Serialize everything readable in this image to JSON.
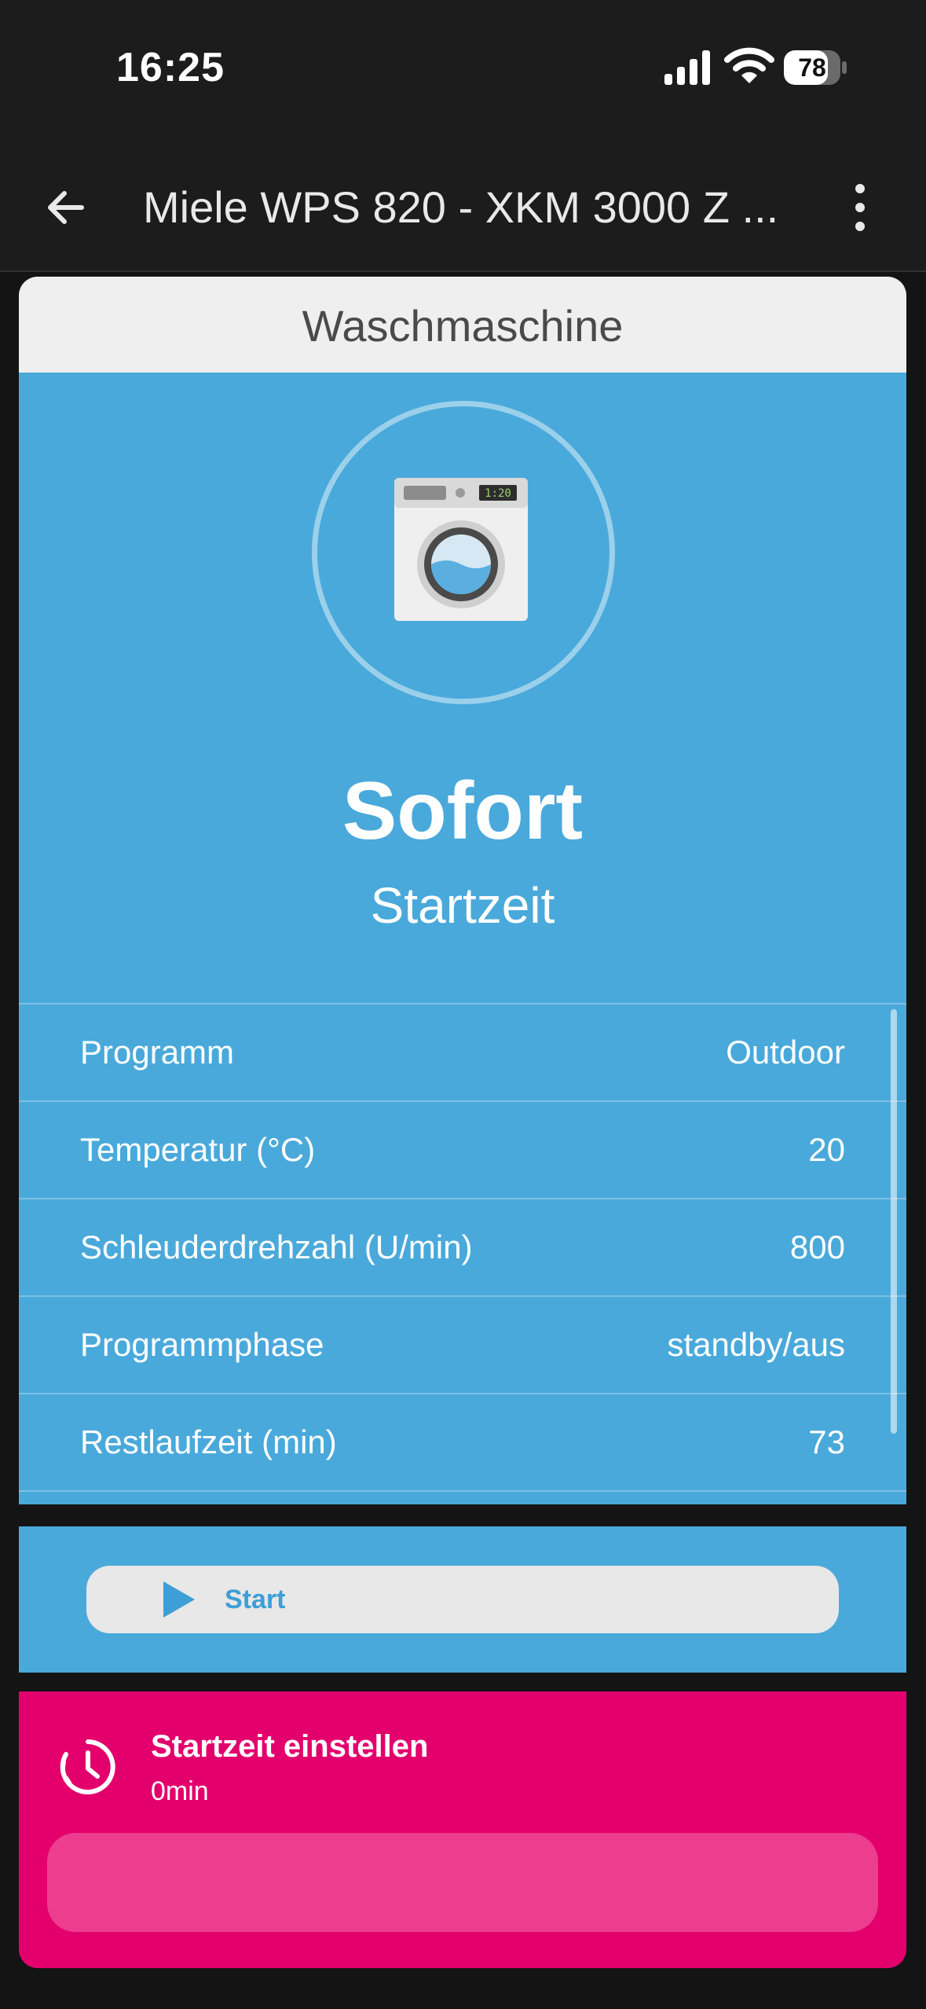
{
  "status_bar": {
    "time": "16:25",
    "battery_level": "78",
    "battery_fraction": 0.78
  },
  "app_bar": {
    "title": "Miele WPS 820 - XKM 3000 Z ...",
    "back_icon": "arrow-left-icon",
    "menu_icon": "more-vertical-icon"
  },
  "card": {
    "header": "Waschmaschine",
    "device_icon": "washing-machine-icon",
    "washer_display": "1:20",
    "big_value": "Sofort",
    "big_label": "Startzeit",
    "rows": [
      {
        "key": "Programm",
        "value": "Outdoor"
      },
      {
        "key": "Temperatur (°C)",
        "value": "20"
      },
      {
        "key": "Schleuderdrehzahl (U/min)",
        "value": "800"
      },
      {
        "key": "Programmphase",
        "value": "standby/aus"
      },
      {
        "key": "Restlaufzeit (min)",
        "value": "73"
      }
    ]
  },
  "start_button": {
    "label": "Start",
    "icon": "play-icon"
  },
  "timer": {
    "title": "Startzeit einstellen",
    "value": "0min",
    "icon": "clock-icon"
  },
  "colors": {
    "card_blue": "#4aa9db",
    "timer_magenta": "#e3006d",
    "appbar_bg": "#1c1c1c"
  }
}
